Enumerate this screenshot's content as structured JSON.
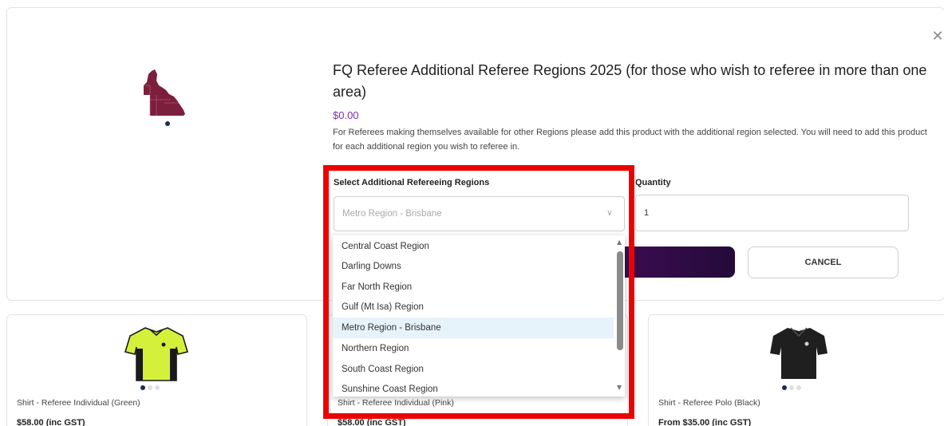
{
  "modal": {
    "title": "FQ Referee Additional Referee Regions 2025 (for those who wish to referee in more than one area)",
    "price": "$0.00",
    "description": "For Referees making themselves available for other Regions please add this product with the additional region selected. You will need to add this product for each additional region you wish to referee in.",
    "region_label": "Select Additional Refereeing Regions",
    "region_selected": "Metro Region - Brisbane",
    "quantity_label": "Quantity",
    "quantity_value": "1",
    "cancel_label": "CANCEL",
    "close_icon": "close-icon"
  },
  "dropdown": {
    "options": [
      "Central Coast Region",
      "Darling Downs",
      "Far North Region",
      "Gulf (Mt Isa) Region",
      "Metro Region - Brisbane",
      "Northern Region",
      "South Coast Region",
      "Sunshine Coast Region"
    ],
    "selected": "Metro Region - Brisbane"
  },
  "cards": [
    {
      "name": "Shirt - Referee Individual (Green)",
      "price": "$58.00 (inc GST)"
    },
    {
      "name": "Shirt - Referee Individual (Pink)",
      "price": "$58.00 (inc GST)"
    },
    {
      "name": "Shirt - Referee Polo (Black)",
      "price": "From $35.00 (inc GST)"
    }
  ],
  "colors": {
    "accent_price": "#7c2bb5",
    "primary_button": "#3a0c4f",
    "highlight": "#ee0000",
    "map_maroon": "#7b1f3c"
  }
}
